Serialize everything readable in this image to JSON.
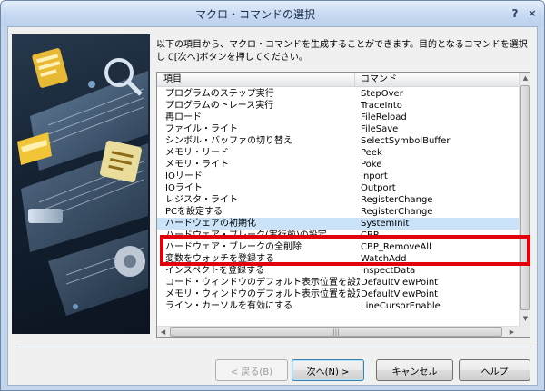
{
  "window": {
    "title": "マクロ・コマンドの選択",
    "help_glyph": "?",
    "close_glyph": "×"
  },
  "instruction": "以下の項目から、マクロ・コマンドを生成することができます。目的となるコマンドを選択して[次へ]ボタンを押してください。",
  "list": {
    "columns": [
      "項目",
      "コマンド"
    ],
    "rows": [
      {
        "item": "プログラムのステップ実行",
        "command": "StepOver"
      },
      {
        "item": "プログラムのトレース実行",
        "command": "TraceInto"
      },
      {
        "item": "再ロード",
        "command": "FileReload"
      },
      {
        "item": "ファイル・ライト",
        "command": "FileSave"
      },
      {
        "item": "シンボル・バッファの切り替え",
        "command": "SelectSymbolBuffer"
      },
      {
        "item": "メモリ・リード",
        "command": "Peek"
      },
      {
        "item": "メモリ・ライト",
        "command": "Poke"
      },
      {
        "item": "IOリード",
        "command": "Inport"
      },
      {
        "item": "IOライト",
        "command": "Outport"
      },
      {
        "item": "レジスタ・ライト",
        "command": "RegisterChange"
      },
      {
        "item": "PCを設定する",
        "command": "RegisterChange"
      },
      {
        "item": "ハードウェアの初期化",
        "command": "SystemInit"
      },
      {
        "item": "ハードウェア・ブレーク(実行前)の設定",
        "command": "CBP"
      },
      {
        "item": "ハードウェア・ブレークの全削除",
        "command": "CBP_RemoveAll"
      },
      {
        "item": "変数をウォッチを登録する",
        "command": "WatchAdd"
      },
      {
        "item": "インスペクトを登録する",
        "command": "InspectData"
      },
      {
        "item": "コード・ウィンドウのデフォルト表示位置を設定する",
        "command": "DefaultViewPoint"
      },
      {
        "item": "メモリ・ウィンドウのデフォルト表示位置を設定する",
        "command": "DefaultViewPoint"
      },
      {
        "item": "ライン・カーソルを有効にする",
        "command": "LineCursorEnable"
      }
    ],
    "selected_index": 11
  },
  "buttons": {
    "back": "< 戻る(B)",
    "next": "次へ(N) >",
    "cancel": "キャンセル",
    "help": "ヘルプ"
  },
  "colors": {
    "highlight_border": "#e3000b",
    "selection": "#cbe3f8"
  }
}
